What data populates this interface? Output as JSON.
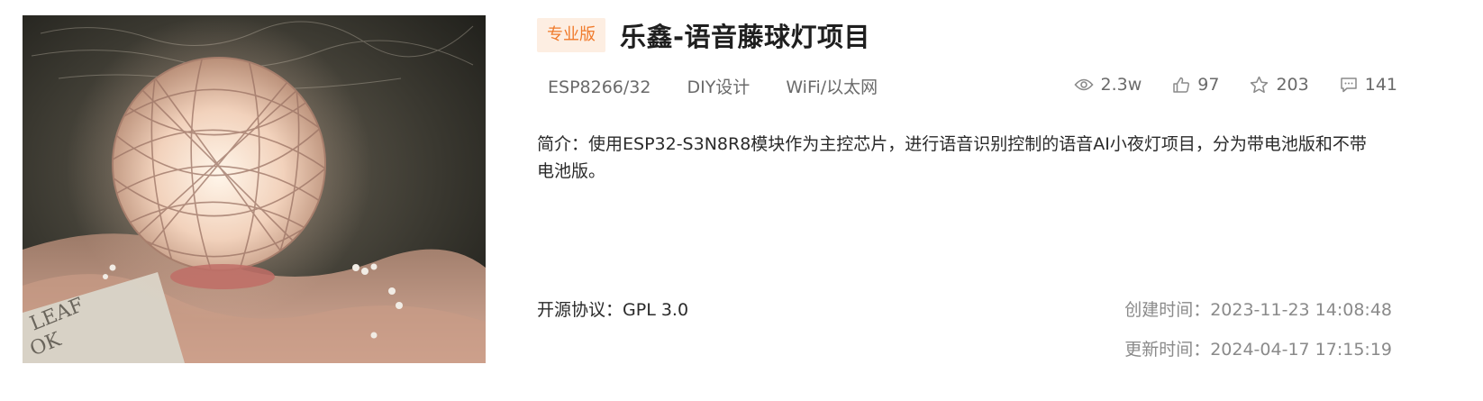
{
  "project": {
    "edition_badge": "专业版",
    "title": "乐鑫-语音藤球灯项目",
    "tags": [
      "ESP8266/32",
      "DIY设计",
      "WiFi/以太网"
    ],
    "stats": {
      "views": "2.3w",
      "likes": "97",
      "favorites": "203",
      "comments": "141"
    },
    "intro": "简介：使用ESP32-S3N8R8模块作为主控芯片，进行语音识别控制的语音AI小夜灯项目，分为带电池版和不带电池版。",
    "license_label": "开源协议：",
    "license_value": "GPL 3.0",
    "created_label": "创建时间：",
    "created_value": "2023-11-23 14:08:48",
    "updated_label": "更新时间：",
    "updated_value": "2024-04-17 17:15:19"
  },
  "icons": {
    "views": "eye-icon",
    "likes": "thumbs-up-icon",
    "favorites": "star-icon",
    "comments": "comment-icon"
  },
  "colors": {
    "badge_bg": "#fdeee2",
    "badge_text": "#f07a2b",
    "muted_text": "#6a6a6a"
  }
}
